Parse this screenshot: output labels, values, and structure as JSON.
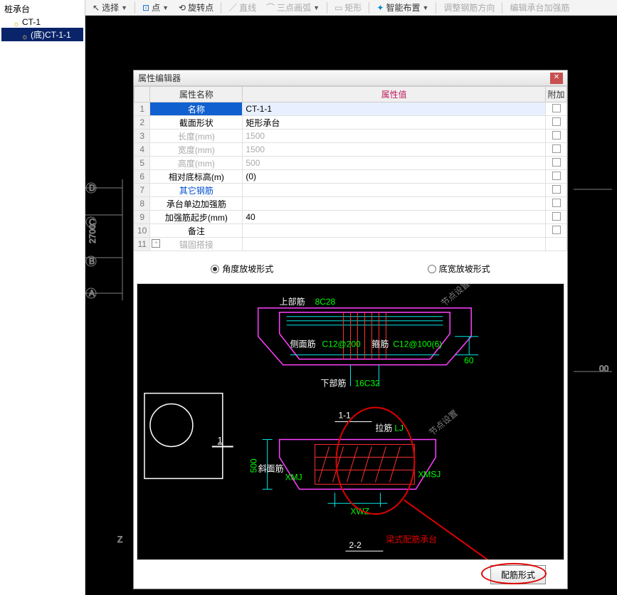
{
  "toolbar": {
    "select": "选择",
    "point": "点",
    "rotate_pt": "旋转点",
    "line": "直线",
    "arc3": "三点画弧",
    "rect": "矩形",
    "smart": "智能布置",
    "adjust_rebar": "调整钢筋方向",
    "edit_strengthen": "编辑承台加强筋"
  },
  "tree": {
    "root": "桩承台",
    "node1": "CT-1",
    "node2": "(底)CT-1-1"
  },
  "dialog": {
    "title": "属性编辑器",
    "headers": {
      "name": "属性名称",
      "value": "属性值",
      "add": "附加"
    },
    "rows": [
      {
        "n": "1",
        "k": "名称",
        "v": "CT-1-1",
        "sel": true
      },
      {
        "n": "2",
        "k": "截面形状",
        "v": "矩形承台"
      },
      {
        "n": "3",
        "k": "长度(mm)",
        "v": "1500",
        "dim": true
      },
      {
        "n": "4",
        "k": "宽度(mm)",
        "v": "1500",
        "dim": true
      },
      {
        "n": "5",
        "k": "高度(mm)",
        "v": "500",
        "dim": true
      },
      {
        "n": "6",
        "k": "相对底标高(m)",
        "v": "(0)"
      },
      {
        "n": "7",
        "k": "其它钢筋",
        "v": "",
        "link": true
      },
      {
        "n": "8",
        "k": "承台单边加强筋",
        "v": ""
      },
      {
        "n": "9",
        "k": "加强筋起步(mm)",
        "v": "40"
      },
      {
        "n": "10",
        "k": "备注",
        "v": ""
      },
      {
        "n": "11",
        "k": "锚固搭接",
        "v": "",
        "dim": true,
        "exp": true,
        "noChk": true
      }
    ],
    "radio1": "角度放坡形式",
    "radio2": "底宽放坡形式",
    "footer_btn": "配筋形式"
  },
  "diagram_labels": {
    "top_rebar": "上部筋",
    "top_rebar_val": "8C28",
    "bottom_rebar": "下部筋",
    "bottom_rebar_val": "16C32",
    "side_rebar": "侧面筋",
    "side_rebar_val": "C12@200",
    "stirrup": "箍筋",
    "stirrup_val": "C12@100(6)",
    "sixty": "60",
    "five_hundred": "500",
    "one_label": "1",
    "sec_11": "1-1",
    "sec_22": "2-2",
    "tie": "拉筋",
    "tie_val": "LJ",
    "xmsj": "XMSJ",
    "xwz": "XWZ",
    "xmj": "XMJ",
    "slope_rebar": "斜面筋",
    "hover_set": "节点设置"
  },
  "callout": {
    "text": "梁式配筋承台"
  },
  "canvas": {
    "dim2700": "2700",
    "dim00": "00",
    "z": "Z",
    "a": "A",
    "b": "B",
    "c": "C",
    "d": "D"
  }
}
